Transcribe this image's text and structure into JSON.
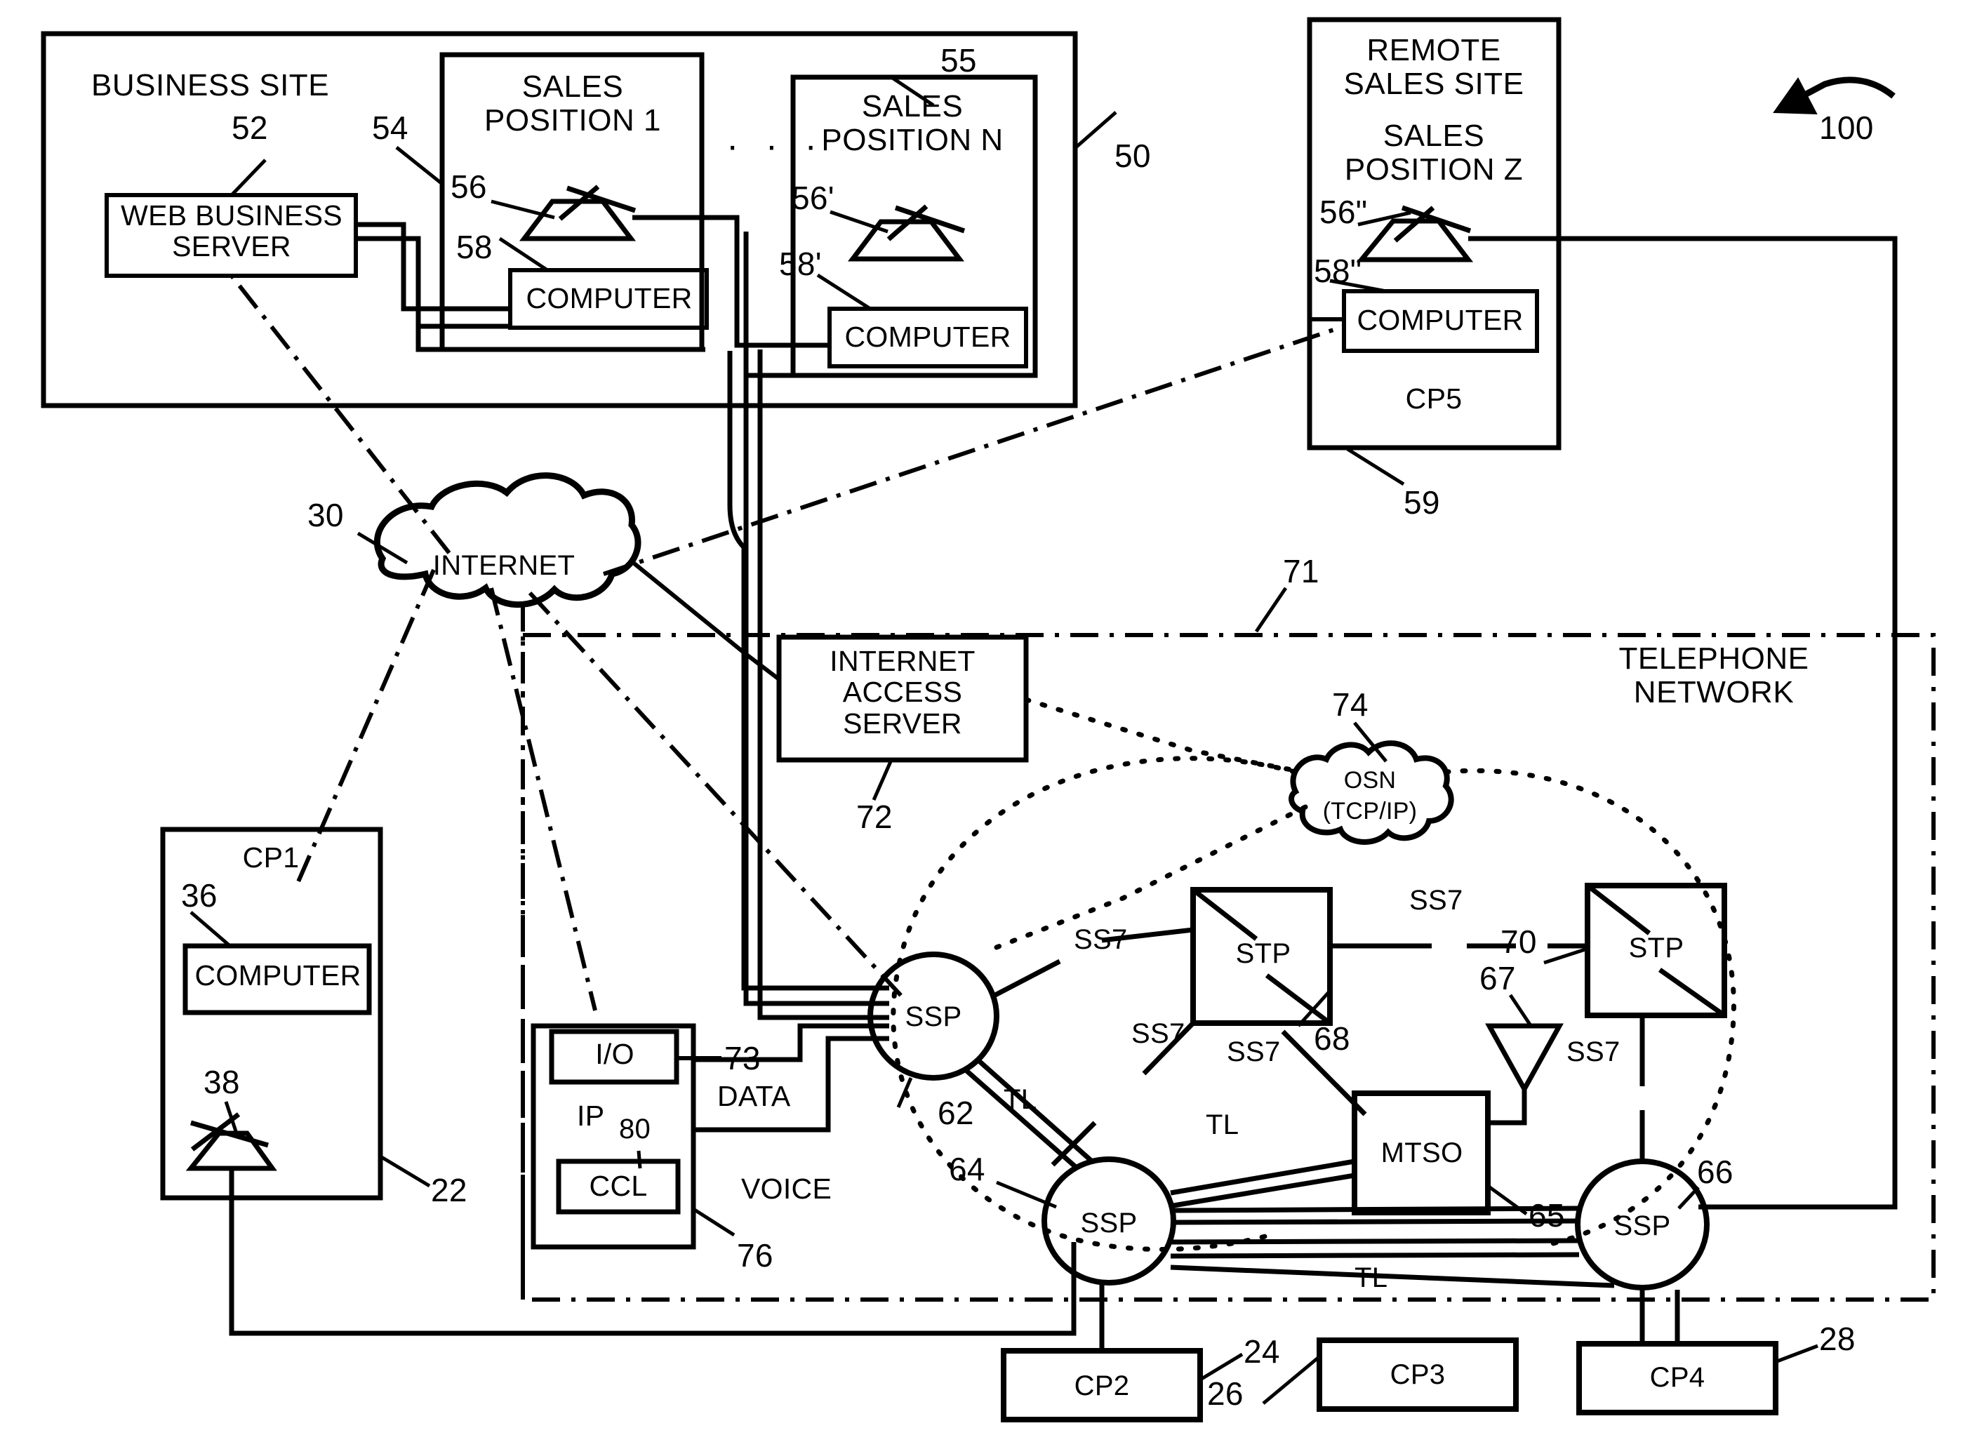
{
  "figure": {
    "reference_numeral": "100",
    "type": "patent-diagram"
  },
  "business_site": {
    "title": "BUSINESS SITE",
    "ref": "50",
    "web_business_server": {
      "label": "WEB BUSINESS\nSERVER",
      "ref": "52"
    },
    "link_ref": "54",
    "ellipsis": "· · ·",
    "sales_position_1": {
      "title": "SALES\nPOSITION 1",
      "phone_ref": "56",
      "computer_label": "COMPUTER",
      "computer_ref": "58"
    },
    "sales_position_n": {
      "title": "SALES\nPOSITION N",
      "box_ref": "55",
      "phone_ref": "56'",
      "computer_label": "COMPUTER",
      "computer_ref": "58'"
    }
  },
  "remote_sales_site": {
    "title": "REMOTE\nSALES SITE",
    "subtitle": "SALES\nPOSITION Z",
    "phone_ref": "56\"",
    "computer_ref": "58\"",
    "computer_label": "COMPUTER",
    "cp_label": "CP5",
    "ref": "59"
  },
  "internet": {
    "label": "INTERNET",
    "ref": "30"
  },
  "telephone_network": {
    "label": "TELEPHONE\nNETWORK",
    "ref": "71"
  },
  "internet_access_server": {
    "label": "INTERNET\nACCESS\nSERVER",
    "ref": "72"
  },
  "osn": {
    "label": "OSN",
    "protocol": "(TCP/IP)",
    "ref": "74"
  },
  "cp1": {
    "label": "CP1",
    "computer_label": "COMPUTER",
    "computer_ref": "36",
    "phone_ref": "38",
    "ref": "22"
  },
  "ip_node": {
    "title": "IP",
    "title_ref": "80",
    "io_label": "I/O",
    "io_ref": "73",
    "ccl_label": "CCL",
    "ref": "76",
    "data_label": "DATA",
    "voice_label": "VOICE"
  },
  "ssp_nodes": [
    {
      "label": "SSP",
      "ref": "62"
    },
    {
      "label": "SSP",
      "ref": "64"
    },
    {
      "label": "SSP",
      "ref": "66"
    }
  ],
  "stp_nodes": [
    {
      "label": "STP",
      "ref": "68"
    },
    {
      "label": "STP",
      "ref": "70"
    }
  ],
  "mtso": {
    "label": "MTSO",
    "ref": "65"
  },
  "antenna": {
    "ref": "67"
  },
  "links": {
    "ss7_1": "SS7",
    "ss7_2": "SS7",
    "ss7_3": "SS7",
    "ss7_4": "SS7",
    "ss7_5": "SS7",
    "ss7_6": "SS7",
    "tl_1": "TL",
    "tl_2": "TL",
    "tl_3": "TL"
  },
  "customer_premises": [
    {
      "label": "CP2",
      "ref": "24"
    },
    {
      "label": "CP3",
      "ref": "26"
    },
    {
      "label": "CP4",
      "ref": "28"
    }
  ]
}
